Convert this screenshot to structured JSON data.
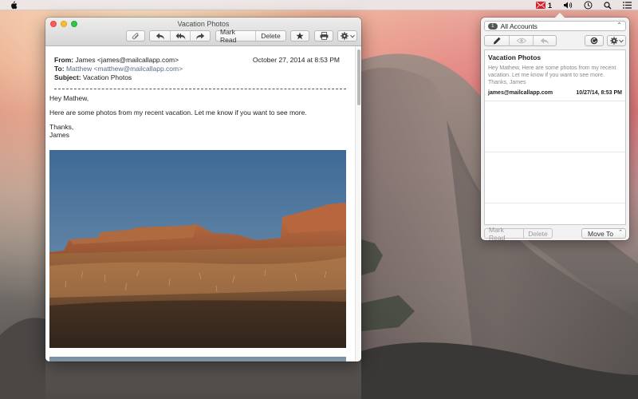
{
  "menubar": {
    "mail_count": "1",
    "icons": [
      "apple-icon",
      "mail-icon",
      "volume-icon",
      "time-machine-icon",
      "spotlight-icon",
      "notification-center-icon"
    ]
  },
  "message_window": {
    "title": "Vacation Photos",
    "toolbar": {
      "attach_icon": "paperclip-icon",
      "reply_icon": "reply-icon",
      "reply_all_icon": "reply-all-icon",
      "forward_icon": "forward-icon",
      "mark_read_label": "Mark Read",
      "delete_label": "Delete",
      "flag_icon": "star-icon",
      "print_icon": "printer-icon",
      "action_icon": "gear-icon"
    },
    "header": {
      "from_label": "From:",
      "from_value": "James <james@mailcallapp.com>",
      "date": "October 27, 2014 at 8:53 PM",
      "to_label": "To:",
      "to_value": "Matthew <matthew@mailcallapp.com>",
      "subject_label": "Subject:",
      "subject_value": "Vacation Photos"
    },
    "body": {
      "greeting": "Hey Mathew,",
      "line1": "Here are some photos from my recent vacation. Let me know if you want to see more.",
      "closing": "Thanks,",
      "signature": "James"
    }
  },
  "popover": {
    "account_count": "1",
    "account_label": "All Accounts",
    "toolbar_icons": [
      "compose-icon",
      "eye-icon",
      "reply-icon",
      "refresh-icon",
      "gear-icon"
    ],
    "message": {
      "subject": "Vacation Photos",
      "preview": "Hey Mathew, Here are some photos from my recent vacation. Let me know if you want to see more. Thanks, James",
      "from": "james@mailcallapp.com",
      "date": "10/27/14, 8:53 PM"
    },
    "footer": {
      "mark_read_label": "Mark Read",
      "delete_label": "Delete",
      "move_to_label": "Move To"
    }
  },
  "colors": {
    "mail_badge": "#d8202a",
    "close": "#fc5b57",
    "minimize": "#f7bf32",
    "maximize": "#2ec844"
  }
}
